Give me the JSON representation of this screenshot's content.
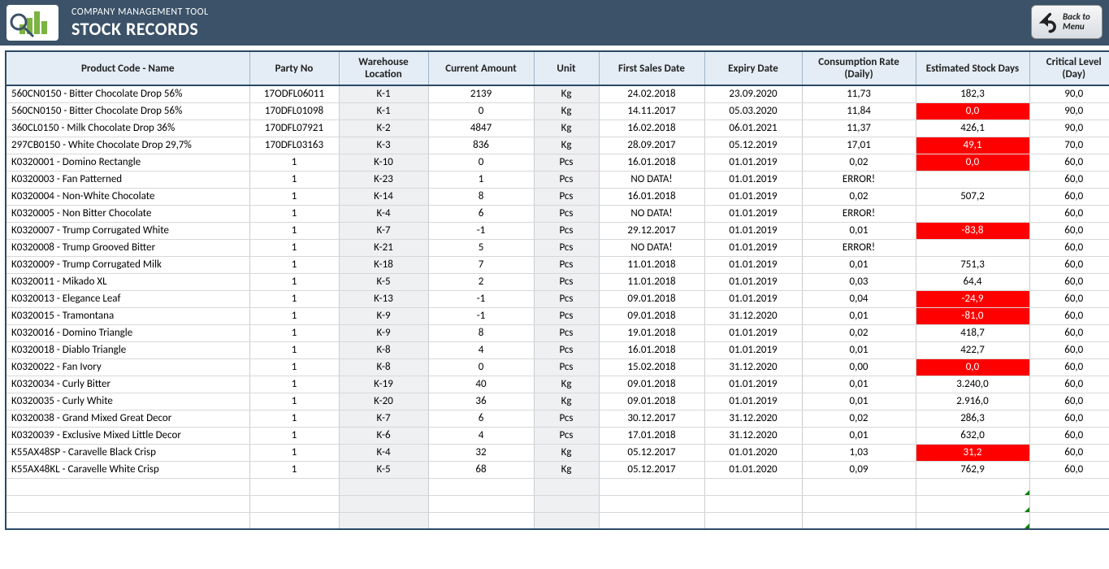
{
  "header": {
    "subtitle": "COMPANY MANAGEMENT TOOL",
    "title": "STOCK RECORDS",
    "back_button": "Back to Menu"
  },
  "columns": [
    "Product Code - Name",
    "Party No",
    "Warehouse Location",
    "Current Amount",
    "Unit",
    "First Sales Date",
    "Expiry Date",
    "Consumption Rate (Daily)",
    "Estimated Stock Days",
    "Critical Level (Day)"
  ],
  "rows": [
    {
      "name": "560CN0150 - Bitter Chocolate Drop 56%",
      "party": "17ODFL06011",
      "loc": "K-1",
      "amt": "2139",
      "unit": "Kg",
      "first": "24.02.2018",
      "exp": "23.09.2020",
      "rate": "11,73",
      "est": "182,3",
      "est_alert": false,
      "crit": "90,0"
    },
    {
      "name": "560CN0150 - Bitter Chocolate Drop 56%",
      "party": "170DFL01098",
      "loc": "K-1",
      "amt": "0",
      "unit": "Kg",
      "first": "14.11.2017",
      "exp": "05.03.2020",
      "rate": "11,84",
      "est": "0,0",
      "est_alert": true,
      "crit": "90,0"
    },
    {
      "name": "360CL0150 - Milk Chocolate Drop 36%",
      "party": "170DFL07921",
      "loc": "K-2",
      "amt": "4847",
      "unit": "Kg",
      "first": "16.02.2018",
      "exp": "06.01.2021",
      "rate": "11,37",
      "est": "426,1",
      "est_alert": false,
      "crit": "90,0"
    },
    {
      "name": "297CB0150 - White Chocolate Drop 29,7%",
      "party": "170DFL03163",
      "loc": "K-3",
      "amt": "836",
      "unit": "Kg",
      "first": "28.09.2017",
      "exp": "05.12.2019",
      "rate": "17,01",
      "est": "49,1",
      "est_alert": true,
      "crit": "70,0"
    },
    {
      "name": "K0320001 - Domino Rectangle",
      "party": "1",
      "loc": "K-10",
      "amt": "0",
      "unit": "Pcs",
      "first": "16.01.2018",
      "exp": "01.01.2019",
      "rate": "0,02",
      "est": "0,0",
      "est_alert": true,
      "crit": "60,0"
    },
    {
      "name": "K0320003 - Fan Patterned",
      "party": "1",
      "loc": "K-23",
      "amt": "1",
      "unit": "Pcs",
      "first": "NO DATA!",
      "exp": "01.01.2019",
      "rate": "ERROR!",
      "est": "",
      "est_alert": false,
      "crit": "60,0"
    },
    {
      "name": "K0320004 - Non-White Chocolate",
      "party": "1",
      "loc": "K-14",
      "amt": "8",
      "unit": "Pcs",
      "first": "16.01.2018",
      "exp": "01.01.2019",
      "rate": "0,02",
      "est": "507,2",
      "est_alert": false,
      "crit": "60,0"
    },
    {
      "name": "K0320005 - Non Bitter Chocolate",
      "party": "1",
      "loc": "K-4",
      "amt": "6",
      "unit": "Pcs",
      "first": "NO DATA!",
      "exp": "01.01.2019",
      "rate": "ERROR!",
      "est": "",
      "est_alert": false,
      "crit": "60,0"
    },
    {
      "name": "K0320007 - Trump Corrugated White",
      "party": "1",
      "loc": "K-7",
      "amt": "-1",
      "unit": "Pcs",
      "first": "29.12.2017",
      "exp": "01.01.2019",
      "rate": "0,01",
      "est": "-83,8",
      "est_alert": true,
      "crit": "60,0"
    },
    {
      "name": "K0320008 - Trump Grooved Bitter",
      "party": "1",
      "loc": "K-21",
      "amt": "5",
      "unit": "Pcs",
      "first": "NO DATA!",
      "exp": "01.01.2019",
      "rate": "ERROR!",
      "est": "",
      "est_alert": false,
      "crit": "60,0"
    },
    {
      "name": "K0320009 - Trump Corrugated Milk",
      "party": "1",
      "loc": "K-18",
      "amt": "7",
      "unit": "Pcs",
      "first": "11.01.2018",
      "exp": "01.01.2019",
      "rate": "0,01",
      "est": "751,3",
      "est_alert": false,
      "crit": "60,0"
    },
    {
      "name": "K0320011 - Mikado XL",
      "party": "1",
      "loc": "K-5",
      "amt": "2",
      "unit": "Pcs",
      "first": "11.01.2018",
      "exp": "01.01.2019",
      "rate": "0,03",
      "est": "64,4",
      "est_alert": false,
      "crit": "60,0"
    },
    {
      "name": "K0320013 - Elegance Leaf",
      "party": "1",
      "loc": "K-13",
      "amt": "-1",
      "unit": "Pcs",
      "first": "09.01.2018",
      "exp": "01.01.2019",
      "rate": "0,04",
      "est": "-24,9",
      "est_alert": true,
      "crit": "60,0"
    },
    {
      "name": "K0320015 - Tramontana",
      "party": "1",
      "loc": "K-9",
      "amt": "-1",
      "unit": "Pcs",
      "first": "09.01.2018",
      "exp": "31.12.2020",
      "rate": "0,01",
      "est": "-81,0",
      "est_alert": true,
      "crit": "60,0"
    },
    {
      "name": "K0320016 - Domino Triangle",
      "party": "1",
      "loc": "K-9",
      "amt": "8",
      "unit": "Pcs",
      "first": "19.01.2018",
      "exp": "01.01.2019",
      "rate": "0,02",
      "est": "418,7",
      "est_alert": false,
      "crit": "60,0"
    },
    {
      "name": "K0320018 - Diablo Triangle",
      "party": "1",
      "loc": "K-8",
      "amt": "4",
      "unit": "Pcs",
      "first": "16.01.2018",
      "exp": "01.01.2019",
      "rate": "0,01",
      "est": "422,7",
      "est_alert": false,
      "crit": "60,0"
    },
    {
      "name": "K0320022 - Fan Ivory",
      "party": "1",
      "loc": "K-8",
      "amt": "0",
      "unit": "Pcs",
      "first": "15.02.2018",
      "exp": "31.12.2020",
      "rate": "0,00",
      "est": "0,0",
      "est_alert": true,
      "crit": "60,0"
    },
    {
      "name": "K0320034 - Curly Bitter",
      "party": "1",
      "loc": "K-19",
      "amt": "40",
      "unit": "Kg",
      "first": "09.01.2018",
      "exp": "01.01.2019",
      "rate": "0,01",
      "est": "3.240,0",
      "est_alert": false,
      "crit": "60,0"
    },
    {
      "name": "K0320035 - Curly White",
      "party": "1",
      "loc": "K-20",
      "amt": "36",
      "unit": "Kg",
      "first": "09.01.2018",
      "exp": "01.01.2019",
      "rate": "0,01",
      "est": "2.916,0",
      "est_alert": false,
      "crit": "60,0"
    },
    {
      "name": "K0320038 - Grand Mixed Great Decor",
      "party": "1",
      "loc": "K-7",
      "amt": "6",
      "unit": "Pcs",
      "first": "30.12.2017",
      "exp": "31.12.2020",
      "rate": "0,02",
      "est": "286,3",
      "est_alert": false,
      "crit": "60,0"
    },
    {
      "name": "K0320039 - Exclusive Mixed Little Decor",
      "party": "1",
      "loc": "K-6",
      "amt": "4",
      "unit": "Pcs",
      "first": "17.01.2018",
      "exp": "31.12.2020",
      "rate": "0,01",
      "est": "632,0",
      "est_alert": false,
      "crit": "60,0"
    },
    {
      "name": "K55AX48SP - Caravelle Black Crisp",
      "party": "1",
      "loc": "K-4",
      "amt": "32",
      "unit": "Kg",
      "first": "05.12.2017",
      "exp": "01.01.2020",
      "rate": "1,03",
      "est": "31,2",
      "est_alert": true,
      "crit": "60,0"
    },
    {
      "name": "K55AX48KL - Caravelle White Crisp",
      "party": "1",
      "loc": "K-5",
      "amt": "68",
      "unit": "Kg",
      "first": "05.12.2017",
      "exp": "01.01.2020",
      "rate": "0,09",
      "est": "762,9",
      "est_alert": false,
      "crit": "60,0"
    }
  ],
  "empty_rows": 3
}
